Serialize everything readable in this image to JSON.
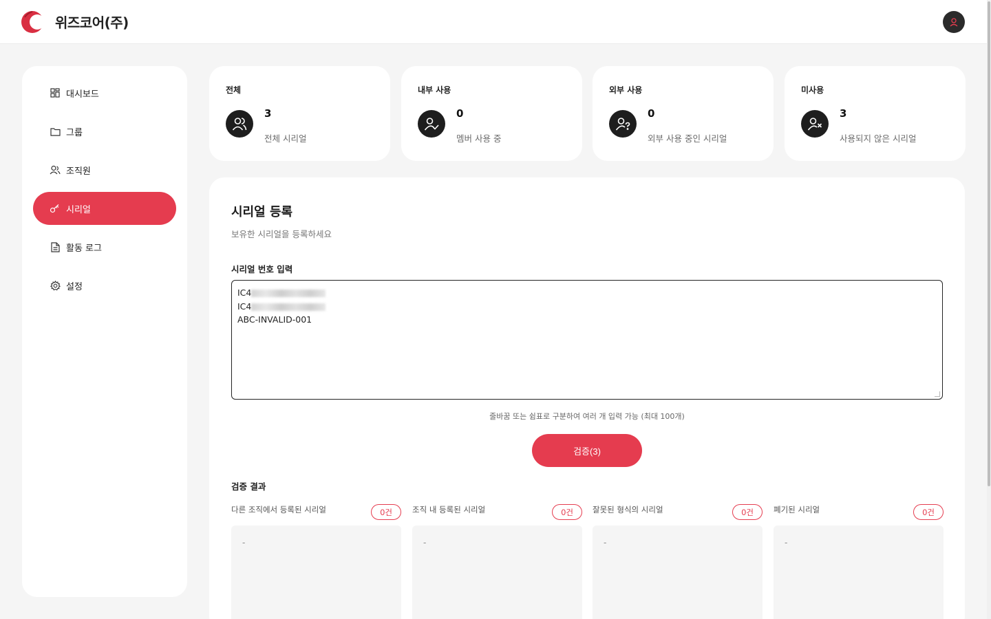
{
  "header": {
    "company_name": "위즈코어(주)",
    "logo_icon": "crescent-logo-icon",
    "avatar_icon": "user-icon",
    "brand_color": "#e53c4f"
  },
  "sidebar": {
    "items": [
      {
        "label": "대시보드",
        "icon": "dashboard-grid-icon",
        "active": false
      },
      {
        "label": "그룹",
        "icon": "folder-icon",
        "active": false
      },
      {
        "label": "조직원",
        "icon": "users-icon",
        "active": false
      },
      {
        "label": "시리얼",
        "icon": "key-icon",
        "active": true
      },
      {
        "label": "활동 로그",
        "icon": "document-icon",
        "active": false
      },
      {
        "label": "설정",
        "icon": "gear-icon",
        "active": false
      }
    ]
  },
  "stats": [
    {
      "title": "전체",
      "value": "3",
      "desc": "전체 시리얼",
      "icon": "users-icon"
    },
    {
      "title": "내부 사용",
      "value": "0",
      "desc": "멤버 사용 중",
      "icon": "user-check-icon"
    },
    {
      "title": "외부 사용",
      "value": "0",
      "desc": "외부 사용 중인 시리얼",
      "icon": "user-question-icon"
    },
    {
      "title": "미사용",
      "value": "3",
      "desc": "사용되지 않은 시리얼",
      "icon": "user-x-icon"
    }
  ],
  "register": {
    "title": "시리얼 등록",
    "subtitle": "보유한 시리얼을 등록하세요",
    "field_label": "시리얼 번호 입력",
    "lines": [
      {
        "prefix": "IC4",
        "redacted": true
      },
      {
        "prefix": "IC4",
        "redacted": true
      },
      {
        "prefix": "ABC-INVALID-001",
        "redacted": false
      }
    ],
    "hint": "줄바꿈 또는 쉼표로 구분하여 여러 개 입력 가능 (최대 100개)",
    "verify_button": "검증(3)"
  },
  "results": {
    "title": "검증 결과",
    "columns": [
      {
        "label": "다른 조직에서 등록된 시리얼",
        "count": "0건",
        "content": "-"
      },
      {
        "label": "조직 내 등록된 시리얼",
        "count": "0건",
        "content": "-"
      },
      {
        "label": "잘못된 형식의 시리얼",
        "count": "0건",
        "content": "-"
      },
      {
        "label": "폐기된 시리얼",
        "count": "0건",
        "content": "-"
      }
    ]
  }
}
